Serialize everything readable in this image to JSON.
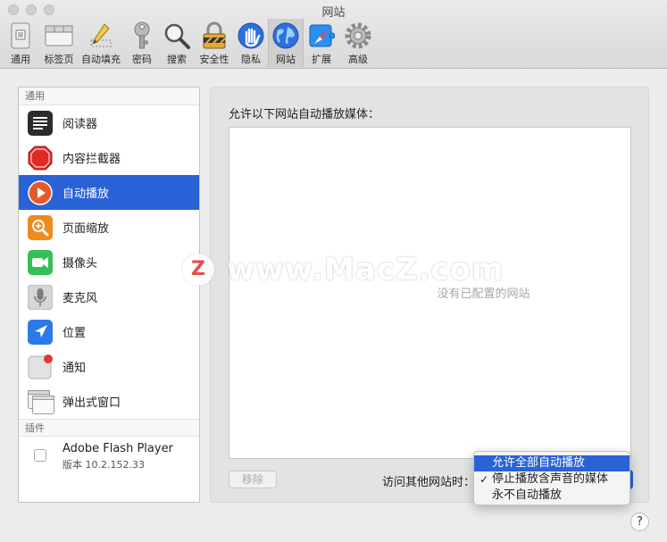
{
  "window": {
    "title": "网站"
  },
  "toolbar": {
    "items": [
      {
        "label": "通用",
        "icon": "general-icon"
      },
      {
        "label": "标签页",
        "icon": "tabs-icon"
      },
      {
        "label": "自动填充",
        "icon": "autofill-icon"
      },
      {
        "label": "密码",
        "icon": "key-icon"
      },
      {
        "label": "搜索",
        "icon": "search-icon"
      },
      {
        "label": "安全性",
        "icon": "lock-icon"
      },
      {
        "label": "隐私",
        "icon": "hand-icon"
      },
      {
        "label": "网站",
        "icon": "globe-icon",
        "active": true
      },
      {
        "label": "扩展",
        "icon": "extensions-icon"
      },
      {
        "label": "高级",
        "icon": "gear-icon"
      }
    ]
  },
  "sidebar": {
    "general_header": "通用",
    "items": [
      {
        "label": "阅读器",
        "icon": "reader-icon"
      },
      {
        "label": "内容拦截器",
        "icon": "stop-sign-icon"
      },
      {
        "label": "自动播放",
        "icon": "play-icon",
        "selected": true
      },
      {
        "label": "页面缩放",
        "icon": "zoom-icon"
      },
      {
        "label": "摄像头",
        "icon": "camera-icon"
      },
      {
        "label": "麦克风",
        "icon": "microphone-icon"
      },
      {
        "label": "位置",
        "icon": "location-icon"
      },
      {
        "label": "通知",
        "icon": "notification-icon"
      },
      {
        "label": "弹出式窗口",
        "icon": "popup-window-icon"
      }
    ],
    "plugins_header": "插件",
    "plugin": {
      "name": "Adobe Flash Player",
      "version": "版本 10.2.152.33"
    }
  },
  "main": {
    "allow_label": "允许以下网站自动播放媒体：",
    "empty_text": "没有已配置的网站",
    "remove_label": "移除",
    "visit_other_label": "访问其他网站时："
  },
  "dropdown": {
    "options": [
      {
        "label": "允许全部自动播放",
        "highlighted": true
      },
      {
        "label": "停止播放含声音的媒体",
        "checked": true
      },
      {
        "label": "永不自动播放"
      }
    ],
    "check_mark": "✓"
  },
  "help": {
    "label": "?"
  },
  "watermark": {
    "logo": "Z",
    "text": "www.MacZ.com"
  },
  "colors": {
    "accent": "#2a63d8"
  }
}
